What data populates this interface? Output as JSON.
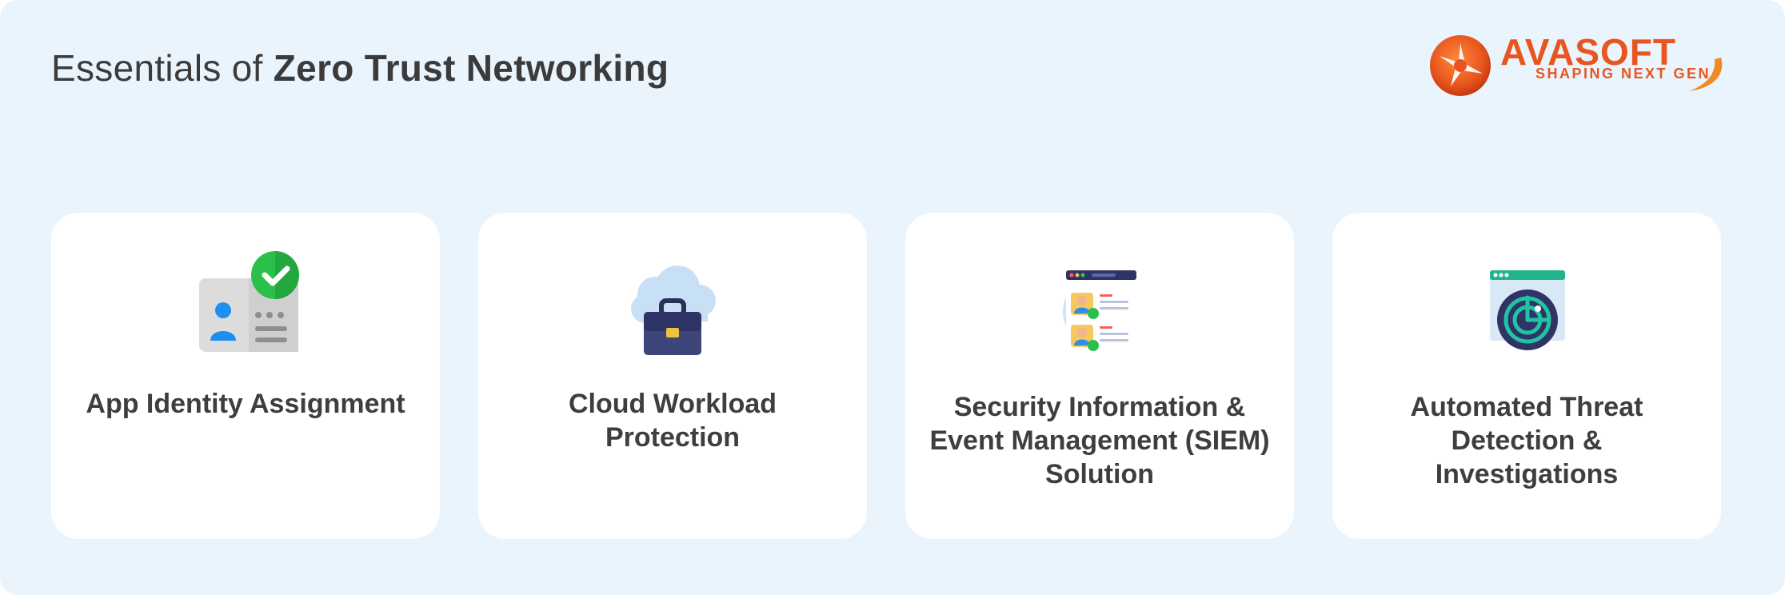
{
  "header": {
    "title_regular": "Essentials of ",
    "title_bold": "Zero Trust Networking"
  },
  "logo": {
    "wordmark": "AVASOFT",
    "tagline": "SHAPING NEXT GEN",
    "color": "#e8551e"
  },
  "cards": [
    {
      "label": "App Identity Assignment",
      "icon": "id-card-check-icon"
    },
    {
      "label": "Cloud Workload Protection",
      "icon": "cloud-briefcase-icon"
    },
    {
      "label": "Security Information & Event Management (SIEM) Solution",
      "icon": "user-verification-window-icon"
    },
    {
      "label": "Automated Threat Detection & Investigations",
      "icon": "radar-window-icon"
    }
  ],
  "colors": {
    "background": "#eaf4fd",
    "card": "#ffffff",
    "text": "#3e3e3e"
  }
}
